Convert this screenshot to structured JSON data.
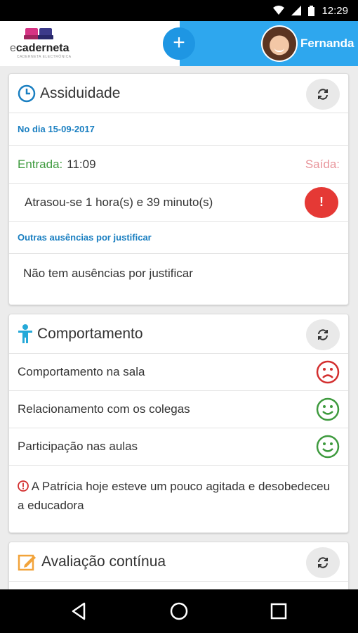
{
  "status_bar": {
    "time": "12:29"
  },
  "header": {
    "logo_text_e": "e",
    "logo_text_main": "caderneta",
    "logo_subtext": "CADERNETA ELECTRÓNICA",
    "user_name": "Fernanda",
    "add_label": "+"
  },
  "attendance": {
    "title": "Assiduidade",
    "date_label": "No dia 15-09-2017",
    "entry_label": "Entrada:",
    "entry_time": "11:09",
    "exit_label": "Saída:",
    "late_text": "Atrasou-se 1 hora(s) e 39 minuto(s)",
    "alert_label": "!",
    "other_absences_label": "Outras ausências por justificar",
    "no_absences_text": "Não tem ausências por justificar"
  },
  "behaviour": {
    "title": "Comportamento",
    "items": [
      {
        "label": "Comportamento na sala",
        "mood": "sad"
      },
      {
        "label": "Relacionamento com os colegas",
        "mood": "happy"
      },
      {
        "label": "Participação nas aulas",
        "mood": "happy"
      }
    ],
    "note": "A Patrícia hoje esteve um pouco agitada e desobedeceu a educadora"
  },
  "evaluation": {
    "title": "Avaliação contínua"
  },
  "colors": {
    "accent_blue": "#2ea7ee",
    "alert_red": "#e53935",
    "happy_green": "#3e9a3e",
    "sad_red": "#d32f2f"
  },
  "icons": {
    "attendance": "clock-icon",
    "behaviour": "person-icon",
    "evaluation": "edit-icon",
    "refresh": "refresh-icon"
  }
}
